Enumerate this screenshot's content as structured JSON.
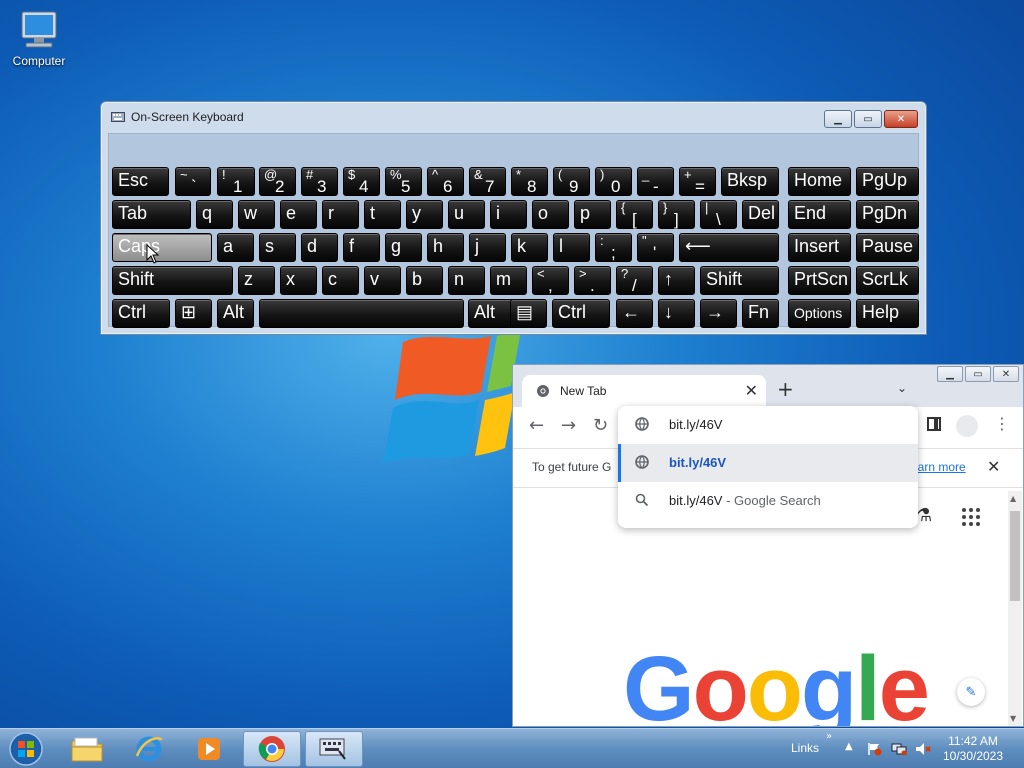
{
  "desktop": {
    "icons": [
      {
        "label": "Computer",
        "icon": "computer-icon"
      }
    ]
  },
  "osk": {
    "title": "On-Screen Keyboard",
    "rows": [
      [
        {
          "t": "Esc"
        },
        {
          "s": "~",
          "b": "`"
        },
        {
          "s": "!",
          "b": "1"
        },
        {
          "s": "@",
          "b": "2"
        },
        {
          "s": "#",
          "b": "3"
        },
        {
          "s": "$",
          "b": "4"
        },
        {
          "s": "%",
          "b": "5"
        },
        {
          "s": "^",
          "b": "6"
        },
        {
          "s": "&",
          "b": "7"
        },
        {
          "s": "*",
          "b": "8"
        },
        {
          "s": "(",
          "b": "9"
        },
        {
          "s": ")",
          "b": "0"
        },
        {
          "s": "_",
          "b": "-"
        },
        {
          "s": "+",
          "b": "="
        },
        {
          "t": "Bksp"
        },
        {
          "t": "Home"
        },
        {
          "t": "PgUp"
        }
      ],
      [
        {
          "t": "Tab"
        },
        {
          "t": "q"
        },
        {
          "t": "w"
        },
        {
          "t": "e"
        },
        {
          "t": "r"
        },
        {
          "t": "t"
        },
        {
          "t": "y"
        },
        {
          "t": "u"
        },
        {
          "t": "i"
        },
        {
          "t": "o"
        },
        {
          "t": "p"
        },
        {
          "s": "{",
          "b": "["
        },
        {
          "s": "}",
          "b": "]"
        },
        {
          "s": "|",
          "b": "\\"
        },
        {
          "t": "Del"
        },
        {
          "t": "End"
        },
        {
          "t": "PgDn"
        }
      ],
      [
        {
          "t": "Caps"
        },
        {
          "t": "a"
        },
        {
          "t": "s"
        },
        {
          "t": "d"
        },
        {
          "t": "f"
        },
        {
          "t": "g"
        },
        {
          "t": "h"
        },
        {
          "t": "j"
        },
        {
          "t": "k"
        },
        {
          "t": "l"
        },
        {
          "s": ":",
          "b": ";"
        },
        {
          "s": "\"",
          "b": "'"
        },
        {
          "t": "⟵"
        },
        {
          "t": "Insert"
        },
        {
          "t": "Pause"
        }
      ],
      [
        {
          "t": "Shift"
        },
        {
          "t": "z"
        },
        {
          "t": "x"
        },
        {
          "t": "c"
        },
        {
          "t": "v"
        },
        {
          "t": "b"
        },
        {
          "t": "n"
        },
        {
          "t": "m"
        },
        {
          "s": "<",
          "b": ","
        },
        {
          "s": ">",
          "b": "."
        },
        {
          "s": "?",
          "b": "/"
        },
        {
          "t": "↑"
        },
        {
          "t": "Shift"
        },
        {
          "t": "PrtScn"
        },
        {
          "t": "ScrLk"
        }
      ],
      [
        {
          "t": "Ctrl"
        },
        {
          "t": "⊞"
        },
        {
          "t": "Alt"
        },
        {
          "t": ""
        },
        {
          "t": "Alt"
        },
        {
          "t": "▤"
        },
        {
          "t": "Ctrl"
        },
        {
          "t": "←"
        },
        {
          "t": "↓"
        },
        {
          "t": "→"
        },
        {
          "t": "Fn"
        },
        {
          "t": "Options"
        },
        {
          "t": "Help"
        }
      ]
    ]
  },
  "chrome": {
    "tab_title": "New Tab",
    "omnibox_value": "bit.ly/46V",
    "info_text": "To get future G",
    "info_link": "earn more",
    "google_logo": "Google",
    "suggestions": [
      {
        "text": "bit.ly/46V",
        "suffix": "",
        "icon": "globe-icon"
      },
      {
        "text": "bit.ly/46V",
        "suffix": " - Google Search",
        "icon": "search-icon"
      }
    ]
  },
  "taskbar": {
    "links_label": "Links",
    "time": "11:42 AM",
    "date": "10/30/2023"
  },
  "colors": {
    "google_blue": "#4285f4",
    "google_red": "#ea4335",
    "google_yellow": "#fbbc05",
    "google_green": "#34a853"
  }
}
